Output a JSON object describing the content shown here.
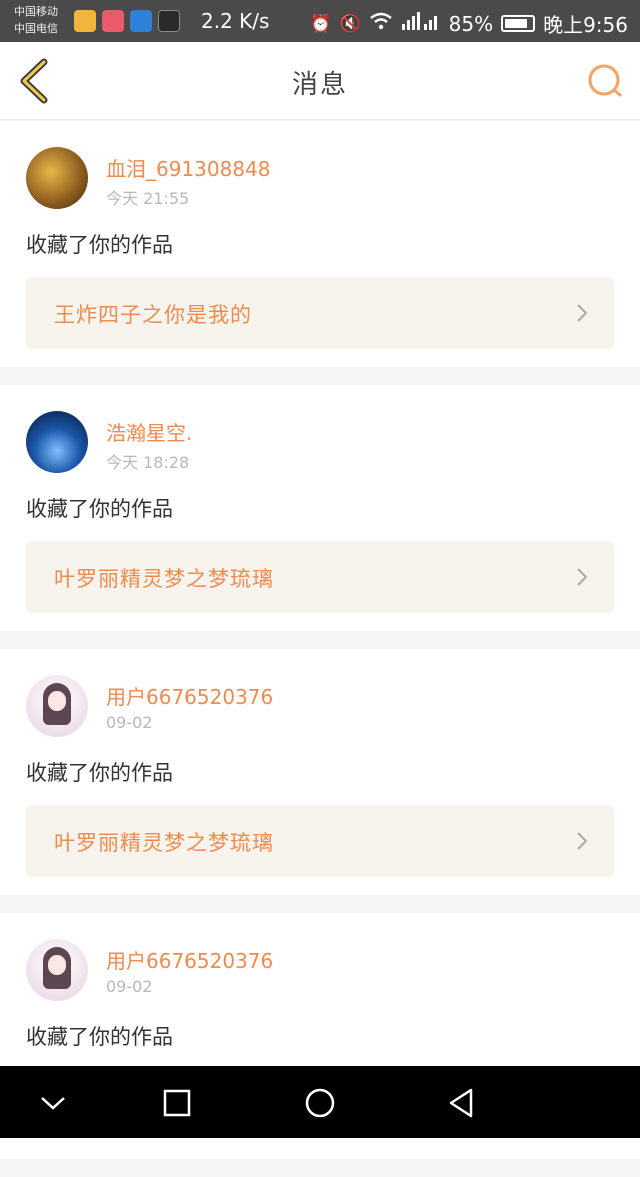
{
  "status_bar": {
    "carrier_1": "中国移动",
    "carrier_2": "中国电信",
    "network_speed": "2.2 K/s",
    "battery_percent": "85%",
    "time": "晚上9:56"
  },
  "header": {
    "title": "消息"
  },
  "messages": [
    {
      "username": "血泪_691308848",
      "time": "今天 21:55",
      "action": "收藏了你的作品",
      "work_title": "王炸四子之你是我的"
    },
    {
      "username": "浩瀚星空.",
      "time": "今天 18:28",
      "action": "收藏了你的作品",
      "work_title": "叶罗丽精灵梦之梦琉璃"
    },
    {
      "username": "用户6676520376",
      "time": "09-02",
      "action": "收藏了你的作品",
      "work_title": "叶罗丽精灵梦之梦琉璃"
    },
    {
      "username": "用户6676520376",
      "time": "09-02",
      "action": "收藏了你的作品",
      "work_title": ""
    }
  ],
  "colors": {
    "accent": "#f08a4e",
    "link_background": "#f6f4ec"
  }
}
